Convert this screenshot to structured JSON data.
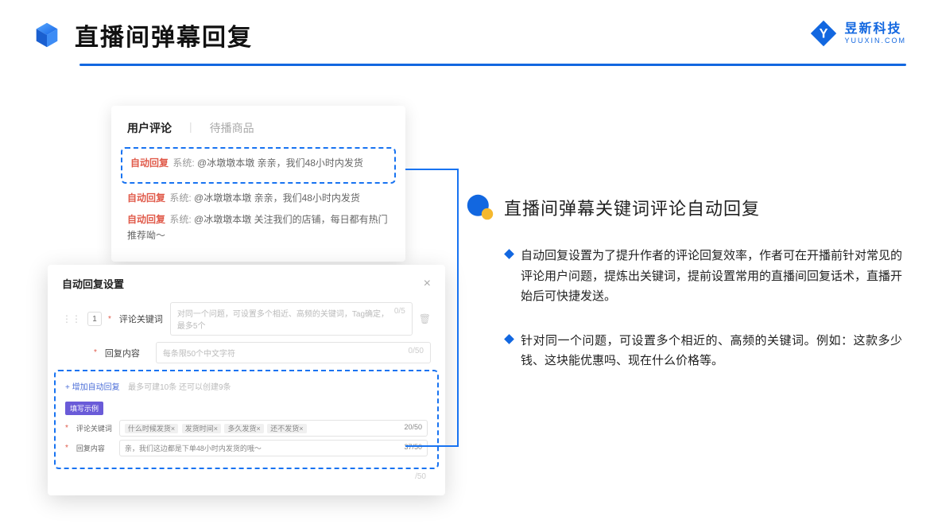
{
  "header": {
    "title": "直播间弹幕回复"
  },
  "logo": {
    "cn": "昱新科技",
    "en": "YUUXIN.COM"
  },
  "card_back": {
    "tab_active": "用户评论",
    "tab_inactive": "待播商品",
    "highlight": {
      "tag": "自动回复",
      "sys": "系统:",
      "body": "@冰墩墩本墩 亲亲，我们48小时内发货"
    },
    "rows": [
      {
        "tag": "自动回复",
        "sys": "系统:",
        "body": "@冰墩墩本墩 亲亲，我们48小时内发货"
      },
      {
        "tag": "自动回复",
        "sys": "系统:",
        "body": "@冰墩墩本墩 关注我们的店铺，每日都有热门推荐呦～"
      }
    ]
  },
  "card_front": {
    "title": "自动回复设置",
    "num": "1",
    "row1_label": "评论关键词",
    "row1_ph": "对同一个问题，可设置多个相近、高频的关键词，Tag确定，最多5个",
    "row1_count": "0/5",
    "row2_label": "回复内容",
    "row2_ph": "每条限50个中文字符",
    "row2_count": "0/50",
    "add_link": "+ 增加自动回复",
    "add_hint": "最多可建10条 还可以创建9条",
    "example_badge": "填写示例",
    "ex1_label": "评论关键词",
    "ex1_chips": [
      "什么时候发货×",
      "发货时间×",
      "多久发货×",
      "还不发货×"
    ],
    "ex1_count": "20/50",
    "ex2_label": "回复内容",
    "ex2_text": "亲，我们这边都是下单48小时内发货的哦～",
    "ex2_count": "37/50",
    "stray_count": "/50"
  },
  "right": {
    "title": "直播间弹幕关键词评论自动回复",
    "bullets": [
      "自动回复设置为了提升作者的评论回复效率，作者可在开播前针对常见的评论用户问题，提炼出关键词，提前设置常用的直播间回复话术，直播开始后可快捷发送。",
      "针对同一个问题，可设置多个相近的、高频的关键词。例如：这款多少钱、这块能优惠吗、现在什么价格等。"
    ]
  }
}
